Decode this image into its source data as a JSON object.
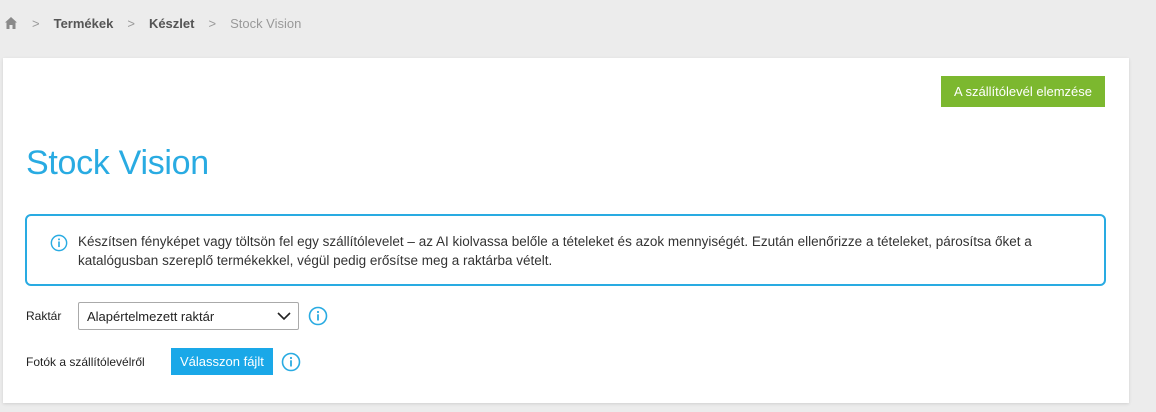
{
  "breadcrumb": {
    "home_icon": "home-icon",
    "items": [
      "Termékek",
      "Készlet"
    ],
    "current": "Stock Vision",
    "separator": ">"
  },
  "header": {
    "analyze_button_label": "A szállítólevél elemzése"
  },
  "page": {
    "title": "Stock Vision"
  },
  "info": {
    "icon": "info-icon",
    "text": "Készítsen fényképet vagy töltsön fel egy szállítólevelet – az AI kiolvassa belőle a tételeket és azok mennyiségét. Ezután ellenőrizze a tételeket, párosítsa őket a katalógusban szereplő termékekkel, végül pedig erősítse meg a raktárba vételt."
  },
  "warehouse": {
    "label": "Raktár",
    "selected": "Alapértelmezett raktár"
  },
  "photos": {
    "label": "Fotók a szállítólevélről",
    "button_label": "Válasszon fájlt"
  },
  "colors": {
    "accent": "#29abe2",
    "primary_button": "#7cb82f",
    "file_button": "#1aa8e8",
    "background": "#ececec"
  }
}
